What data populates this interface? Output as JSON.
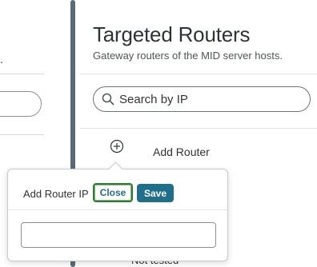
{
  "left_pane": {
    "fragment": "."
  },
  "panel": {
    "title": "Targeted Routers",
    "subtitle": "Gateway routers of the MID server hosts.",
    "search": {
      "placeholder": "Search by IP",
      "icon": "search-icon"
    },
    "add_router": {
      "label": "Add Router",
      "icon": "plus-circle-icon"
    },
    "bottom_fragment": "Not tested"
  },
  "popover": {
    "label": "Add Router IP",
    "close_label": "Close",
    "save_label": "Save",
    "input_value": ""
  },
  "colors": {
    "accent": "#1f6f8b",
    "focus_ring": "#2f7d32",
    "splitter": "#5a6a78",
    "text": "#2e3338"
  }
}
